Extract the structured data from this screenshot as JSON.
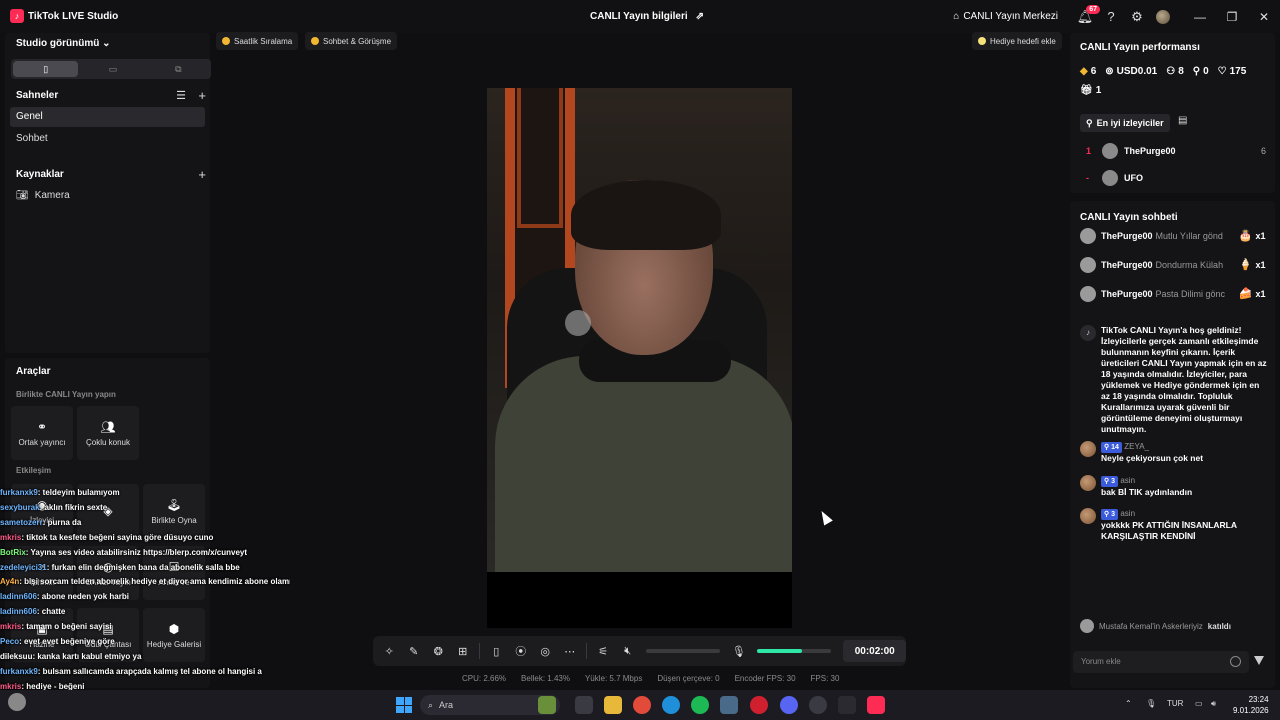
{
  "window": {
    "app_title": "TikTok LIVE Studio",
    "live_info_title": "CANLI Yayın bilgileri",
    "live_center_label": "CANLI Yayın Merkezi",
    "notification_count": "67"
  },
  "left": {
    "studio_view_label": "Studio görünümü",
    "scenes_header": "Sahneler",
    "scenes": [
      "Genel",
      "Sohbet"
    ],
    "sources_header": "Kaynaklar",
    "sources": [
      "Kamera"
    ],
    "tools_header": "Araçlar",
    "collab_subheader": "Birlikte CANLI Yayın yapın",
    "collab_tools": [
      "Ortak yayıncı",
      "Çoklu konuk"
    ],
    "interaction_subheader": "Etkileşim",
    "interaction_tools": [
      "İzleyici",
      "",
      "Birlikte Oyna",
      "Tahmin",
      "CANLI Yayın",
      "Anket ve",
      "Hazine",
      "Ödül Çantası",
      "Hediye Galerisi"
    ]
  },
  "overlay_chat": [
    {
      "user": "furkanxk9",
      "text": ": teldeyim bulamıyom"
    },
    {
      "user": "sexyburak",
      "text": ": aklın fikrin sexte"
    },
    {
      "user": "sametozerr",
      "text": ": purna da"
    },
    {
      "user": "mkris",
      "text": ": tiktok ta kesfete beğeni sayina göre düsuyo cuno"
    },
    {
      "user": "BotRix",
      "text": ": Yayına ses video atabilirsiniz https://blerp.com/x/cunveyt"
    },
    {
      "user": "zedeleyici31",
      "text": ": furkan elin değmişken bana da abonelik salla bbe"
    },
    {
      "user": "Ay4n",
      "text": ": bişi sorcam telden abonelik hediye et diyor ama kendimiz abone olamıyormuyuz"
    },
    {
      "user": "ladinn606",
      "text": ": abone neden yok harbi"
    },
    {
      "user": "ladinn606",
      "text": ": chatte"
    },
    {
      "user": "mkris",
      "text": ": tamam o beğeni sayisi"
    },
    {
      "user": "Peco",
      "text": ": evet evet beğeniye göre"
    },
    {
      "user": "dileksuu",
      "text": ": kanka kartı kabul etmiyo ya"
    },
    {
      "user": "furkanxk9",
      "text": ": bulsam sallıcamda arapçada kalmış tel abone ol hangisi a"
    },
    {
      "user": "mkris",
      "text": ": hediye - beğeni"
    }
  ],
  "center": {
    "chip_hourly": "Saatlik Sıralama",
    "chip_chat": "Sohbet & Görüşme",
    "chip_gift_goal": "Hediye hedefi ekle",
    "timer": "00:02:00",
    "volume_level": 0.6,
    "stats": [
      "CPU: 2.66%",
      "Bellek: 1.43%",
      "Yükle: 5.7 Mbps",
      "Düşen çerçeve: 0",
      "Encoder FPS: 30",
      "FPS: 30"
    ]
  },
  "right": {
    "perf_title": "CANLI Yayın performansı",
    "perf_stats": [
      {
        "icon": "diamond-icon",
        "value": "6"
      },
      {
        "icon": "coin-icon",
        "value": "USD0.01"
      },
      {
        "icon": "users-icon",
        "value": "8"
      },
      {
        "icon": "add-user-icon",
        "value": "0"
      },
      {
        "icon": "heart-icon",
        "value": "175"
      }
    ],
    "gift_stat": "1",
    "top_viewers_label": "En iyi izleyiciler",
    "top_viewers": [
      {
        "rank": "1",
        "name": "ThePurge00",
        "score": "6"
      },
      {
        "rank": "-",
        "name": "UFO",
        "score": ""
      }
    ],
    "chat_title": "CANLI Yayın sohbeti",
    "gifts": [
      {
        "user": "ThePurge00",
        "msg": "Mutlu Yıllar gönd",
        "count": "x1",
        "icon": "🎂"
      },
      {
        "user": "ThePurge00",
        "msg": "Dondurma Külah",
        "count": "x1",
        "icon": "🍦"
      },
      {
        "user": "ThePurge00",
        "msg": "Pasta Dilimi gönc",
        "count": "x1",
        "icon": "🍰"
      }
    ],
    "welcome_text": "TikTok CANLI Yayın'a hoş geldiniz! İzleyicilerle gerçek zamanlı etkileşimde bulunmanın keyfini çıkarın. İçerik üreticileri CANLI Yayın yapmak için en az 18 yaşında olmalıdır. İzleyiciler, para yüklemek ve Hediye göndermek için en az 18 yaşında olmalıdır. Topluluk Kurallarımıza uyarak güvenli bir görüntüleme deneyimi oluşturmayı unutmayın.",
    "messages": [
      {
        "level": "14",
        "name": "ZEYA_",
        "text": "Neyle çekiyorsun çok net"
      },
      {
        "level": "3",
        "name": "asin",
        "text": "bak Bİ TIK aydınlandın"
      },
      {
        "level": "3",
        "name": "asin",
        "text": "yokkkk PK ATTIĞIN İNSANLARLA KARŞILAŞTIR KENDİNİ"
      }
    ],
    "joined_user": "Mustafa Kemal'in Askerleriyiz",
    "joined_text": "katıldı",
    "comment_placeholder": "Yorum ekle"
  },
  "taskbar": {
    "search_label": "Ara",
    "lang": "TUR",
    "time": "23:24",
    "date": "9.01.2026"
  }
}
